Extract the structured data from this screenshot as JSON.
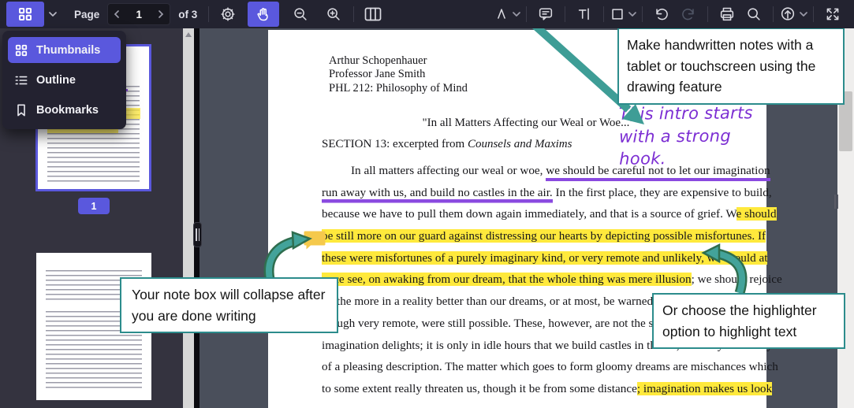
{
  "colors": {
    "accent_purple": "#5a58dd",
    "toolbar_bg": "#232330",
    "panel_bg": "#34333f",
    "doc_area_bg": "#4a4f5b",
    "callout_border": "#2c8c8c",
    "arrow_teal": "#3e9d96",
    "highlight_yellow": "#ffe93c",
    "ink_purple": "#7c2ed3",
    "sticky_note_yellow": "#f5c94c"
  },
  "toolbar": {
    "page_label": "Page",
    "page_value": "1",
    "page_total_label": "of 3",
    "icons": [
      "thumbnails-grid",
      "chevron-down",
      "page-previous",
      "page-next",
      "settings-gear",
      "hand-pan",
      "zoom-out",
      "zoom-in",
      "page-layout-columns",
      "draw-pen",
      "chevron-down",
      "comment-note",
      "text-insert",
      "shape-rectangle",
      "chevron-down",
      "undo",
      "redo",
      "print",
      "search",
      "export-upload",
      "chevron-down",
      "fullscreen-expand"
    ]
  },
  "view_menu": {
    "items": [
      {
        "label": "Thumbnails",
        "icon": "thumbnails-grid-icon",
        "selected": true
      },
      {
        "label": "Outline",
        "icon": "outline-list-icon",
        "selected": false
      },
      {
        "label": "Bookmarks",
        "icon": "bookmark-icon",
        "selected": false
      }
    ]
  },
  "thumbnail_panel": {
    "selected_page_badge": "1",
    "visible_pages": 2
  },
  "document": {
    "author_line1": "Arthur Schopenhauer",
    "author_line2": "Professor Jane Smith",
    "author_line3": "PHL 212: Philosophy of Mind",
    "title": "\"In all Matters Affecting our Weal or Woe...\"",
    "section_prefix": "SECTION 13: excerpted from ",
    "section_work": "Counsels and Maxims",
    "lines": [
      {
        "indent": true,
        "segments": [
          {
            "text": "In all matters affecting our weal or woe, ",
            "mark": "none"
          },
          {
            "text": "we should be careful not to let our imagination",
            "mark": "ink-underline"
          }
        ]
      },
      {
        "segments": [
          {
            "text": "run away with us, and build no castles in the air.",
            "mark": "ink-underline"
          },
          {
            "text": " In the first place, they are expensive to build,",
            "mark": "none"
          }
        ]
      },
      {
        "segments": [
          {
            "text": "because we have to pull them down again immediately, and that is a source of grief. W",
            "mark": "none"
          },
          {
            "text": "e should",
            "mark": "highlight"
          }
        ]
      },
      {
        "segments": [
          {
            "text": "be still more on our guard against distressing our hearts by depicting possible misfortunes. If",
            "mark": "highlight"
          }
        ]
      },
      {
        "segments": [
          {
            "text": "these were misfortunes of a purely imaginary kind, or very remote and unlikely, we should at",
            "mark": "highlight"
          }
        ]
      },
      {
        "segments": [
          {
            "text": "once see, on awaking from our dream, that the whole thing was mere illusion",
            "mark": "highlight"
          },
          {
            "text": "; we should rejoice",
            "mark": "none"
          }
        ]
      },
      {
        "segments": [
          {
            "text": "all the more in a reality better than our dreams, or at most, be warned against misfortunes,",
            "mark": "none"
          }
        ]
      },
      {
        "segments": [
          {
            "text": "though very remote, were still possible. These, however, are not the sort of plaything in which",
            "mark": "none"
          }
        ]
      },
      {
        "segments": [
          {
            "text": "imagination delights; it is only in idle hours that we build castles in the air, and they are always",
            "mark": "none"
          }
        ]
      },
      {
        "segments": [
          {
            "text": "of a pleasing description. The matter which goes to form gloomy dreams are mischances which",
            "mark": "none"
          }
        ]
      },
      {
        "segments": [
          {
            "text": "to some extent really threaten us, though it be from some distance",
            "mark": "none"
          },
          {
            "text": "; imagination makes us look",
            "mark": "highlight"
          }
        ]
      }
    ]
  },
  "annotations": {
    "handwriting": [
      "This intro starts",
      "with a strong",
      "hook."
    ],
    "note_icon": "sticky-note-comment"
  },
  "callouts": {
    "drawing": "Make handwritten notes with a tablet or touchscreen using the drawing feature",
    "note": "Your note box will collapse after you are done writing",
    "highlight": "Or choose the highlighter option to highlight text"
  }
}
